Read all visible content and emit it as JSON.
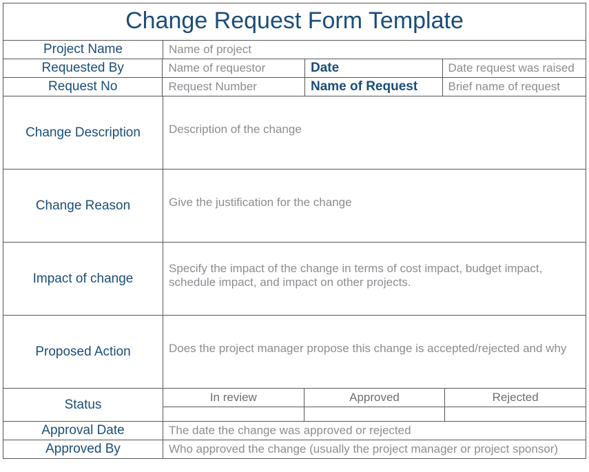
{
  "title": "Change Request Form Template",
  "rows": {
    "project_name_label": "Project Name",
    "project_name_value": "Name of project",
    "requested_by_label": "Requested By",
    "requested_by_value": "Name of requestor",
    "date_label": "Date",
    "date_value": "Date request was raised",
    "request_no_label": "Request No",
    "request_no_value": "Request Number",
    "name_of_request_label": "Name of Request",
    "name_of_request_value": "Brief name of request",
    "change_description_label": "Change Description",
    "change_description_value": "Description of the change",
    "change_reason_label": "Change Reason",
    "change_reason_value": "Give the justification for the change",
    "impact_label": "Impact of change",
    "impact_value": "Specify the impact of the change in terms of cost impact, budget impact, schedule impact, and impact on other projects.",
    "proposed_action_label": "Proposed Action",
    "proposed_action_value": "Does the project manager propose this change is accepted/rejected and why",
    "status_label": "Status",
    "status_options": [
      "In review",
      "Approved",
      "Rejected"
    ],
    "approval_date_label": "Approval Date",
    "approval_date_value": "The date the change was approved or rejected",
    "approved_by_label": "Approved By",
    "approved_by_value": "Who approved the change (usually the project manager or project sponsor)"
  }
}
